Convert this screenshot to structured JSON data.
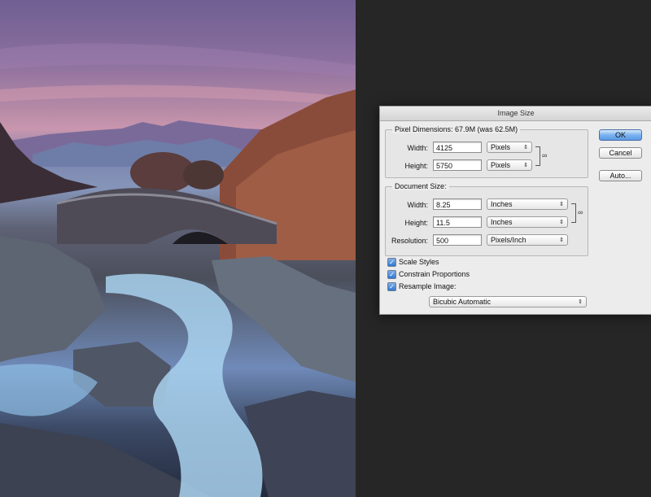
{
  "dialog": {
    "title": "Image Size",
    "pixel_dimensions": {
      "label": "Pixel Dimensions:",
      "summary": "67.9M (was 62.5M)",
      "width_label": "Width:",
      "width_value": "4125",
      "width_unit": "Pixels",
      "height_label": "Height:",
      "height_value": "5750",
      "height_unit": "Pixels"
    },
    "document_size": {
      "label": "Document Size:",
      "width_label": "Width:",
      "width_value": "8.25",
      "width_unit": "Inches",
      "height_label": "Height:",
      "height_value": "11.5",
      "height_unit": "Inches",
      "resolution_label": "Resolution:",
      "resolution_value": "500",
      "resolution_unit": "Pixels/Inch"
    },
    "options": {
      "scale_styles": {
        "label": "Scale Styles",
        "checked": true
      },
      "constrain_proportions": {
        "label": "Constrain Proportions",
        "checked": true
      },
      "resample_image": {
        "label": "Resample Image:",
        "checked": true
      },
      "resample_method": "Bicubic Automatic"
    },
    "buttons": {
      "ok": "OK",
      "cancel": "Cancel",
      "auto": "Auto..."
    },
    "icons": {
      "link": "chain-link-icon",
      "checkmark": "checkmark-icon",
      "dropdown": "updown-arrows-icon"
    },
    "colors": {
      "default_button": "#5a9ae6",
      "dialog_bg": "#ececec",
      "workspace_bg": "#262626"
    }
  },
  "canvas": {
    "scene": "photo-landscape"
  }
}
